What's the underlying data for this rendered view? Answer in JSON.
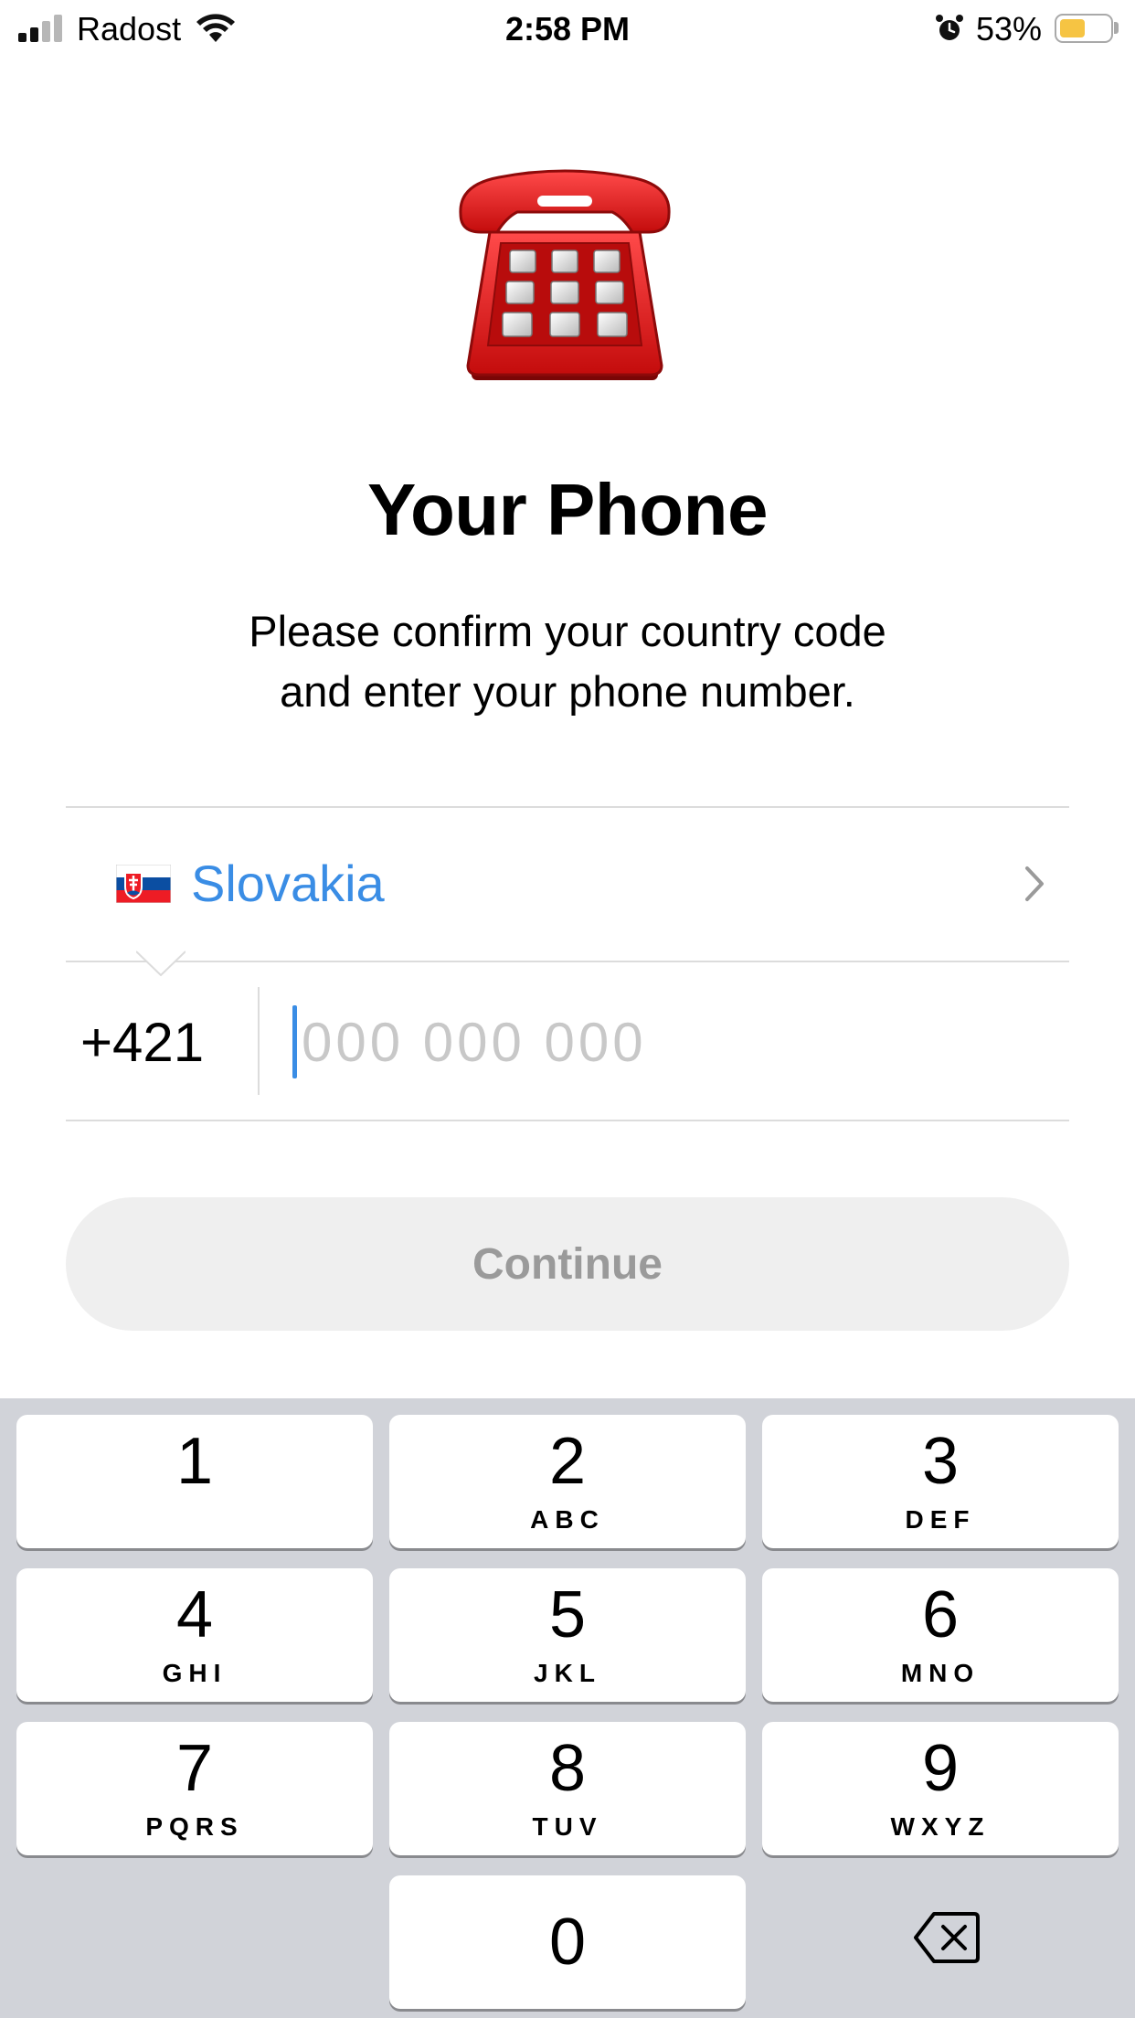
{
  "status_bar": {
    "carrier": "Radost",
    "time": "2:58 PM",
    "battery_percent": "53%",
    "battery_level": 0.53,
    "signal_bars_active": 2,
    "icons": [
      "signal-icon",
      "wifi-icon",
      "alarm-icon",
      "battery-icon"
    ]
  },
  "illustration": "red-telephone-icon",
  "title": "Your Phone",
  "subtitle": {
    "line1": "Please confirm your country code",
    "line2": "and enter your phone number."
  },
  "country": {
    "flag": "slovakia-flag-icon",
    "name": "Slovakia"
  },
  "phone": {
    "code": "+421",
    "value": "",
    "placeholder": "000 000 000"
  },
  "continue_label": "Continue",
  "accent_color": "#3a8de5",
  "keypad": {
    "keys": [
      {
        "digit": "1",
        "letters": ""
      },
      {
        "digit": "2",
        "letters": "ABC"
      },
      {
        "digit": "3",
        "letters": "DEF"
      },
      {
        "digit": "4",
        "letters": "GHI"
      },
      {
        "digit": "5",
        "letters": "JKL"
      },
      {
        "digit": "6",
        "letters": "MNO"
      },
      {
        "digit": "7",
        "letters": "PQRS"
      },
      {
        "digit": "8",
        "letters": "TUV"
      },
      {
        "digit": "9",
        "letters": "WXYZ"
      },
      {
        "digit": "0",
        "letters": ""
      }
    ],
    "delete_icon": "backspace-icon"
  }
}
